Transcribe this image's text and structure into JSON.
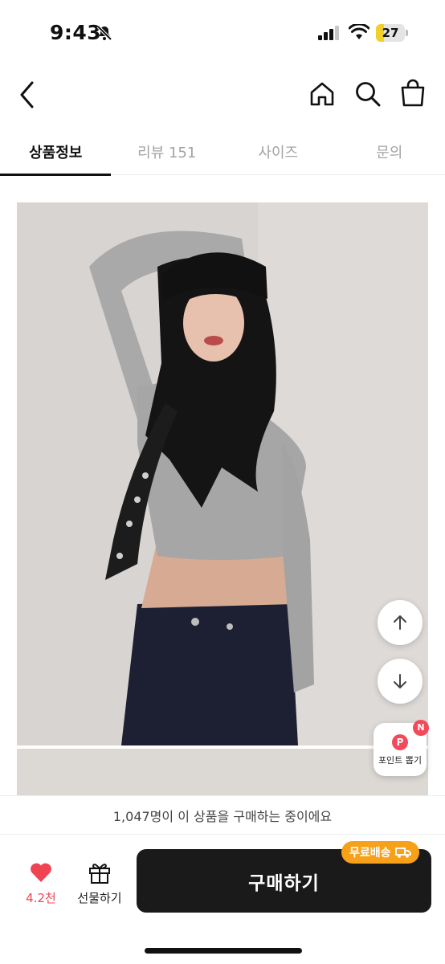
{
  "status_bar": {
    "time": "9:43",
    "battery_level": "27",
    "battery_fraction": 0.27
  },
  "nav": {
    "back_icon": "chevron-left-icon",
    "home_icon": "home-icon",
    "search_icon": "search-icon",
    "cart_icon": "shopping-bag-icon"
  },
  "tabs": [
    {
      "label": "상품정보",
      "active": true
    },
    {
      "label": "리뷰 151",
      "active": false
    },
    {
      "label": "사이즈",
      "active": false
    },
    {
      "label": "문의",
      "active": false
    }
  ],
  "floating": {
    "scroll_up_icon": "arrow-up-icon",
    "scroll_down_icon": "arrow-down-icon",
    "point_badge": "P",
    "point_label": "포인트 뽑기",
    "new_badge": "N"
  },
  "buying_banner": "1,047명이 이 상품을 구매하는 중이에요",
  "bottom_bar": {
    "like_count": "4.2천",
    "gift_label": "선물하기",
    "buy_label": "구매하기",
    "free_shipping_label": "무료배송"
  },
  "colors": {
    "accent_red": "#f04453",
    "buy_button": "#1a1a1a",
    "shipping_badge": "#f7a11a"
  }
}
